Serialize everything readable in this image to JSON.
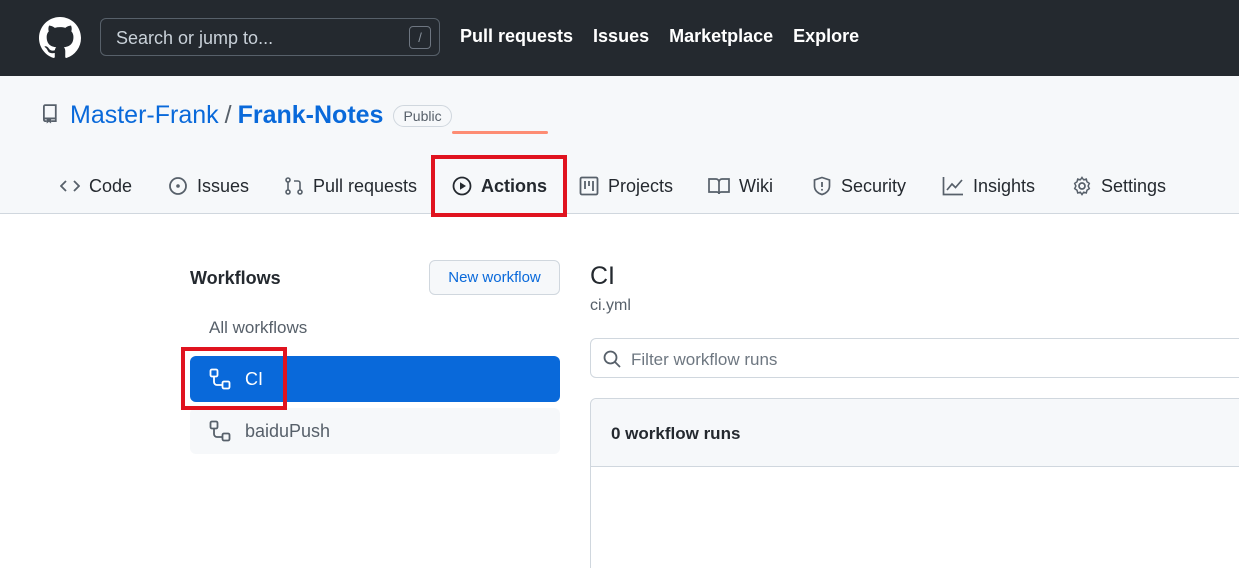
{
  "header": {
    "search_placeholder": "Search or jump to...",
    "search_shortcut": "/",
    "nav": [
      "Pull requests",
      "Issues",
      "Marketplace",
      "Explore"
    ]
  },
  "repo": {
    "owner": "Master-Frank",
    "separator": "/",
    "name": "Frank-Notes",
    "visibility": "Public"
  },
  "tabs": [
    {
      "label": "Code",
      "icon": "code-icon"
    },
    {
      "label": "Issues",
      "icon": "issue-icon"
    },
    {
      "label": "Pull requests",
      "icon": "pull-request-icon"
    },
    {
      "label": "Actions",
      "icon": "play-icon",
      "selected": true
    },
    {
      "label": "Projects",
      "icon": "project-icon"
    },
    {
      "label": "Wiki",
      "icon": "book-icon"
    },
    {
      "label": "Security",
      "icon": "shield-icon"
    },
    {
      "label": "Insights",
      "icon": "graph-icon"
    },
    {
      "label": "Settings",
      "icon": "gear-icon"
    }
  ],
  "sidebar": {
    "title": "Workflows",
    "new_workflow_label": "New workflow",
    "all_workflows_label": "All workflows",
    "workflows": [
      {
        "label": "CI",
        "selected": true
      },
      {
        "label": "baiduPush",
        "selected": false
      }
    ]
  },
  "main": {
    "workflow_title": "CI",
    "workflow_file": "ci.yml",
    "filter_placeholder": "Filter workflow runs",
    "runs_count_label": "0 workflow runs"
  },
  "colors": {
    "header_bg": "#24292f",
    "accent": "#0969da",
    "highlight_box": "#e0131f",
    "tab_underline": "#fd8c73"
  }
}
